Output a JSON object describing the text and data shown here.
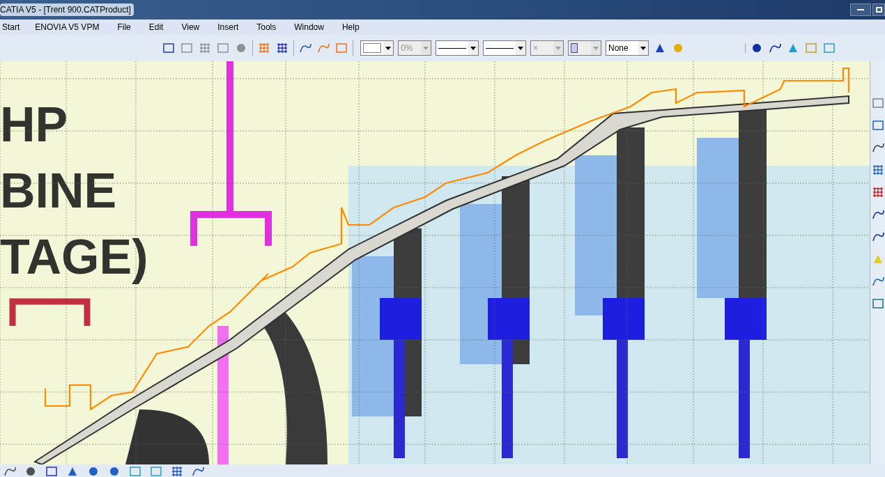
{
  "window": {
    "title": "CATIA V5 - [Trent 900.CATProduct]"
  },
  "menu": [
    "Start",
    "ENOVIA V5 VPM",
    "File",
    "Edit",
    "View",
    "Insert",
    "Tools",
    "Window",
    "Help"
  ],
  "canvas": {
    "image_labels": [
      "HP",
      "BINE",
      "TAGE)"
    ]
  },
  "toolbar": {
    "combos": [
      {
        "kind": "color",
        "disabled": false
      },
      {
        "kind": "text",
        "value": "0%",
        "disabled": true
      },
      {
        "kind": "line",
        "disabled": false
      },
      {
        "kind": "line",
        "disabled": false
      },
      {
        "kind": "text",
        "value": "×",
        "disabled": true
      },
      {
        "kind": "layer",
        "disabled": true
      },
      {
        "kind": "text",
        "value": "None",
        "disabled": false
      }
    ]
  }
}
